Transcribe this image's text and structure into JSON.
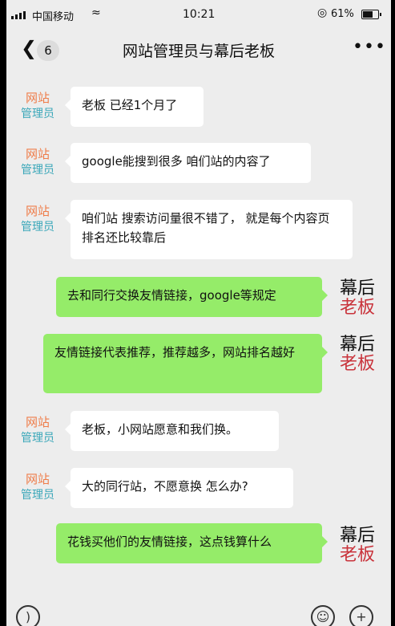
{
  "status_bar": {
    "carrier": "中国移动",
    "time": "10:21",
    "battery": "61%"
  },
  "nav": {
    "back_icon": "chevron-left-icon",
    "unread_count": "6",
    "title": "网站管理员与幕后老板",
    "more_icon": "more-dots-icon"
  },
  "admin_label": {
    "line1": "网站",
    "line2": "管理员"
  },
  "boss_label": {
    "line1": "幕后",
    "line2": "老板"
  },
  "messages": [
    {
      "from": "admin",
      "text": "老板 已经1个月了"
    },
    {
      "from": "admin",
      "text": "google能搜到很多 咱们站的内容了"
    },
    {
      "from": "admin",
      "text": "咱们站 搜索访问量很不错了，      就是每个内容页排名还比较靠后"
    },
    {
      "from": "boss",
      "text": "去和同行交换友情链接，google等规定"
    },
    {
      "from": "boss",
      "text": "友情链接代表推荐，推荐越多，网站排名越好"
    },
    {
      "from": "admin",
      "text": "老板，小网站愿意和我们换。"
    },
    {
      "from": "admin",
      "text": "大的同行站，不愿意换 怎么办?"
    },
    {
      "from": "boss",
      "text": "花钱买他们的友情链接，这点钱算什么"
    }
  ],
  "colors": {
    "chat_background": "#ededed",
    "my_bubble": "#95ec69",
    "other_bubble": "#ffffff",
    "admin_label_top": "#ef7d4a",
    "admin_label_bottom": "#3aa7b9",
    "boss_label_bottom": "#c9333b"
  },
  "toolbar_icons": [
    "voice-icon",
    "emoji-icon",
    "plus-icon"
  ]
}
